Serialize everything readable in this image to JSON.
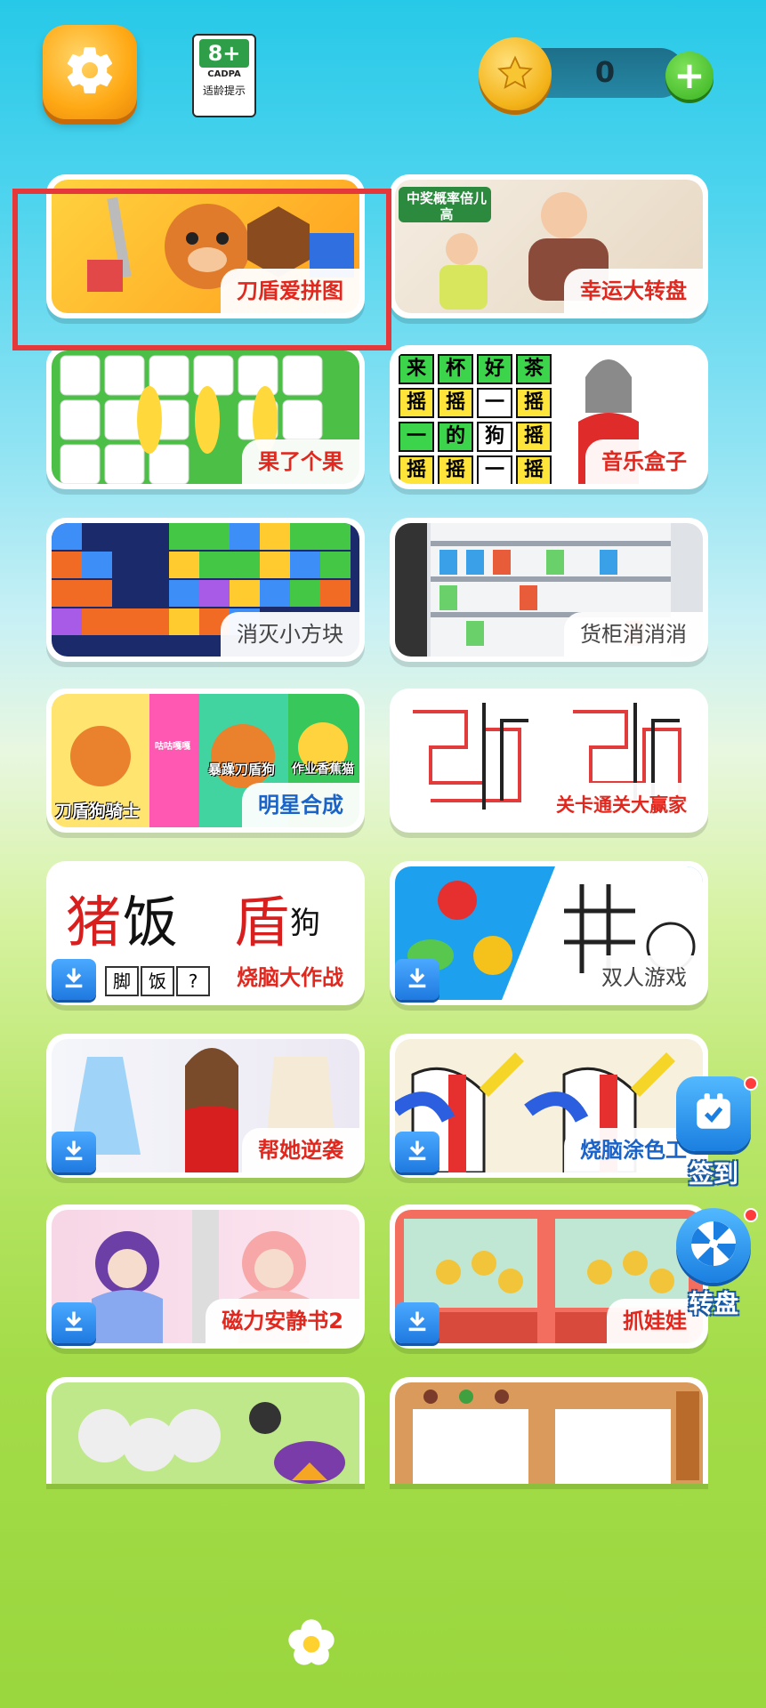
{
  "header": {
    "age_rating": "8+",
    "age_org": "CADPA",
    "age_tip": "适龄提示",
    "coin_count": "0"
  },
  "games": [
    {
      "label": "刀盾爱拼图",
      "color": "red"
    },
    {
      "label": "幸运大转盘",
      "color": "red"
    },
    {
      "label": "果了个果",
      "color": "red"
    },
    {
      "label": "音乐盒子",
      "color": "red"
    },
    {
      "label": "消灭小方块",
      "color": "gray"
    },
    {
      "label": "货柜消消消",
      "color": "gray"
    },
    {
      "label": "明星合成",
      "color": "blue"
    },
    {
      "label": "关卡通关大赢家",
      "color": "red"
    },
    {
      "label": "烧脑大作战",
      "color": "red"
    },
    {
      "label": "双人游戏",
      "color": "gray"
    },
    {
      "label": "帮她逆袭",
      "color": "red"
    },
    {
      "label": "烧脑涂色工",
      "color": "blue"
    },
    {
      "label": "磁力安静书2",
      "color": "red"
    },
    {
      "label": "抓娃娃",
      "color": "red"
    },
    {
      "label": "",
      "color": "red"
    },
    {
      "label": "",
      "color": "red"
    }
  ],
  "card_art_text": {
    "slot_tag": "中奖概率倍儿高",
    "word_grid": [
      "来",
      "杯",
      "好",
      "茶",
      "摇",
      "摇",
      "一",
      "摇",
      "一",
      "的",
      "狗",
      "摇",
      "摇",
      "摇",
      "一",
      "摇"
    ],
    "star_pet_1": "刀盾狗骑士",
    "star_pet_2": "暴躁刀盾狗",
    "star_pet_3": "作业香蕉猫",
    "star_pet_4": "咕咕嘎嘎",
    "brain_chars": [
      "猪",
      "饭",
      "盾",
      "狗"
    ],
    "brain_row": [
      "脚",
      "饭",
      "?"
    ]
  },
  "side": {
    "checkin_label": "签到",
    "wheel_label": "转盘"
  },
  "colors": {
    "accent_red": "#e0281f",
    "accent_blue": "#1a63c9",
    "download_blue": "#1f79e0",
    "highlight_red": "#e5383b"
  }
}
